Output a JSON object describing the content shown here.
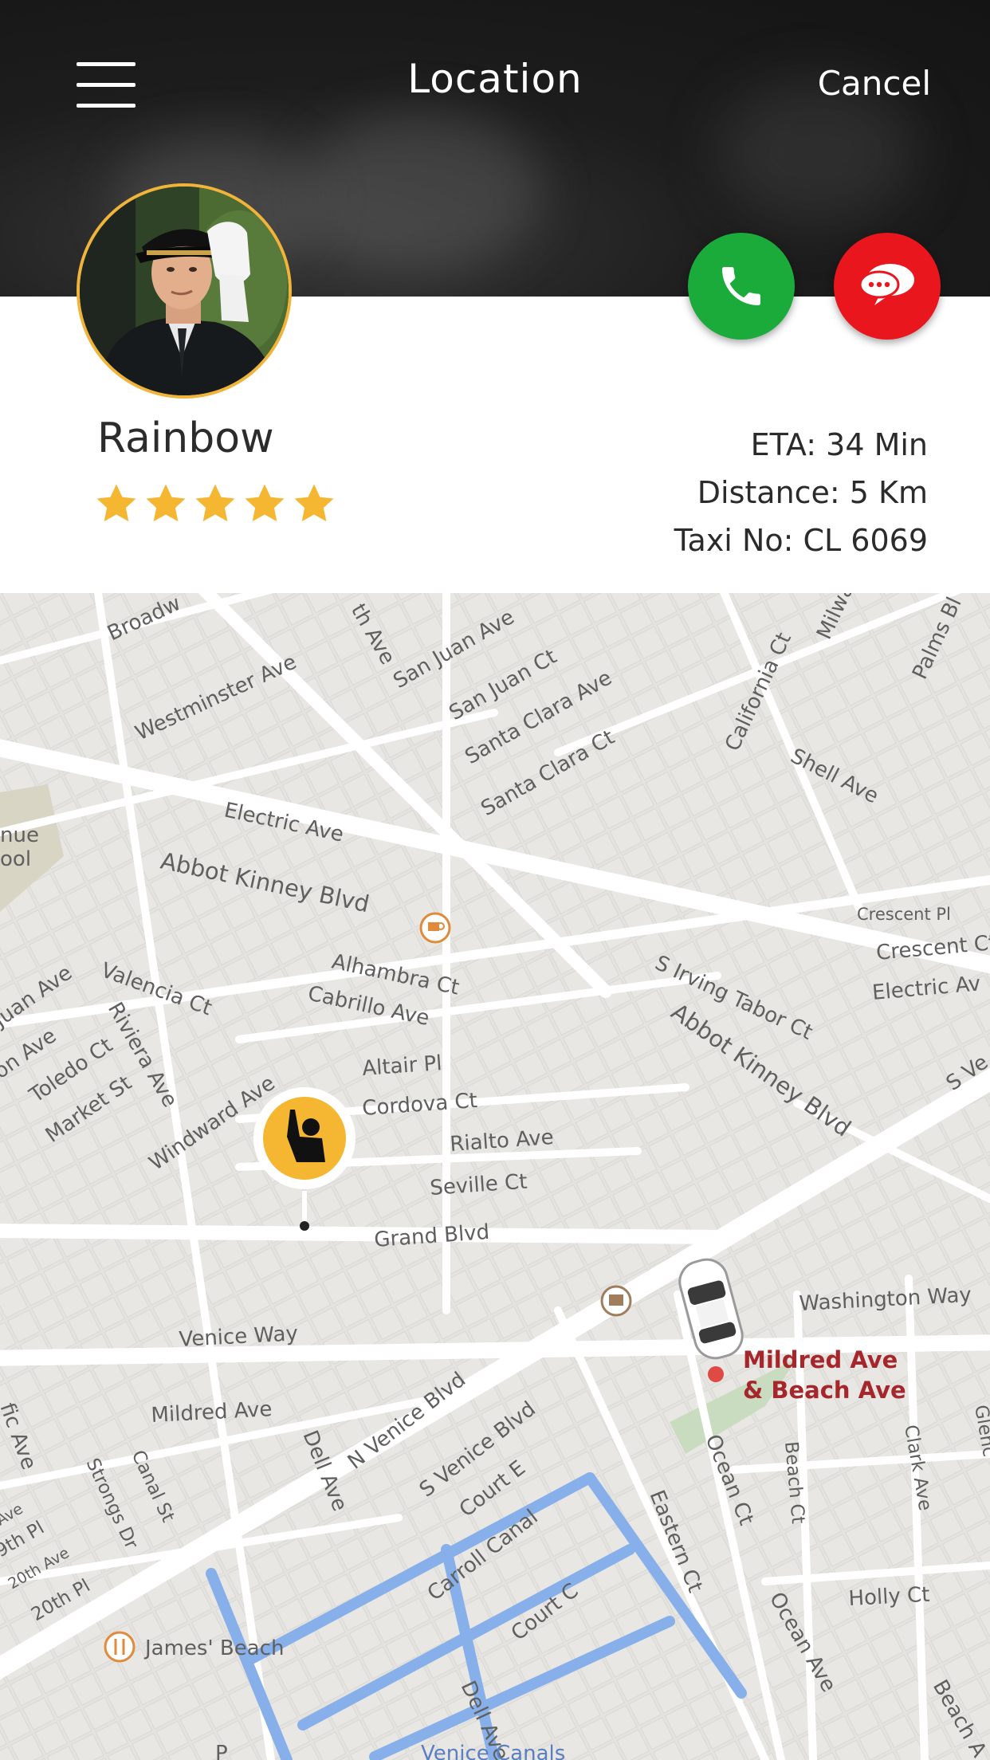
{
  "header": {
    "title": "Location",
    "cancel_label": "Cancel"
  },
  "driver": {
    "name": "Rainbow",
    "rating": 5,
    "rating_max": 5,
    "eta": "ETA: 34 Min",
    "distance": "Distance: 5 Km",
    "taxi_no": "Taxi No: CL 6069"
  },
  "actions": {
    "call_icon": "phone-icon",
    "chat_icon": "chat-icon",
    "call_color": "#1aab3b",
    "chat_color": "#e9161e"
  },
  "colors": {
    "accent": "#f5b731",
    "avatar_border": "#f0b43a"
  },
  "map": {
    "streets": [
      "Broadw",
      "Westminster Ave",
      "th Ave",
      "San Juan Ave",
      "San Juan Ct",
      "Santa Clara Ave",
      "Santa Clara Ct",
      "California Ct",
      "Milwa",
      "Palms Bl",
      "Shell Ave",
      "Electric Ave",
      "Abbot Kinney Blvd",
      "Crescent Pl",
      "Crescent Ct",
      "Electric Av",
      "nue",
      "ool",
      "Alhambra Ct",
      "Cabrillo Ave",
      "S Irving Tabor Ct",
      "Abbot Kinney Blvd",
      "Juan Ave",
      "Valencia Ct",
      "Riviera Ave",
      "on Ave",
      "Toledo Ct",
      "Market St",
      "Windward Ave",
      "Altair Pl",
      "Cordova Ct",
      "Rialto Ave",
      "Seville Ct",
      "Grand Blvd",
      "S Ve",
      "Washington Way",
      "Venice Way",
      "N Venice Blvd",
      "S Venice Blvd",
      "Mildred Ave",
      "Dell Ave",
      "Court E",
      "Ocean Ct",
      "Beach Ct",
      "Clark Ave",
      "Glenc",
      "Eastern Ct",
      "fic Ave",
      "Strongs Dr",
      "Canal St",
      "Ave",
      "9th Pl",
      "20th Ave",
      "20th Pl",
      "Carroll Canal",
      "Court C",
      "Holly Ct",
      "Ocean Ave",
      "Beach A",
      "Dell Ave",
      "Venice Canals",
      "P"
    ],
    "poi_label_1": "Mildred Ave",
    "poi_label_2": "& Beach Ave",
    "beach_label": "James' Beach",
    "user_marker_icon": "waving-person-icon",
    "car_icon": "taxi-car-icon",
    "cafe_icon": "coffee-cup-icon",
    "library_icon": "book-icon",
    "restaurant_icon": "fork-knife-icon"
  }
}
